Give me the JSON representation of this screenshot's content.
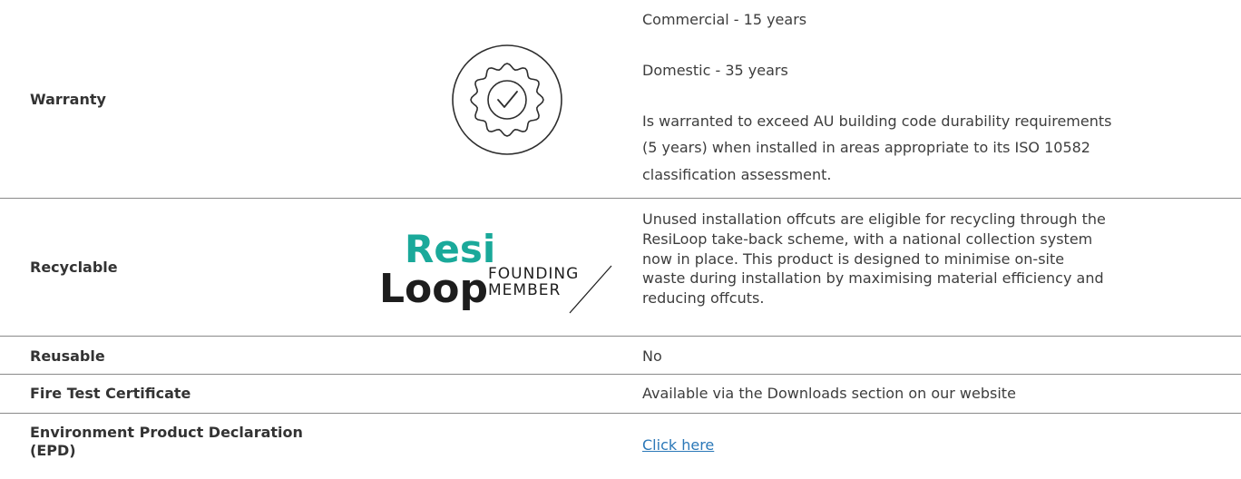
{
  "rows": {
    "warranty": {
      "label": "Warranty",
      "lines": [
        "Commercial - 15 years",
        "Domestic - 35 years",
        "Is warranted to exceed AU building code durability requirements",
        "(5 years) when installed in areas appropriate to its ISO 10582",
        "classification assessment."
      ],
      "icon": "checkmark-badge-icon"
    },
    "recyclable": {
      "label": "Recyclable",
      "lines": [
        "Unused installation offcuts are eligible for recycling through the",
        "ResiLoop take-back scheme, with a national collection system",
        "now in place. This product is designed to minimise on-site",
        "waste during installation by maximising material efficiency and",
        "reducing offcuts."
      ],
      "logo": {
        "word_top": "Resi",
        "word_bottom": "Loop",
        "member_line1": "FOUNDING",
        "member_line2": "MEMBER",
        "accent": "#1aa99a"
      }
    },
    "reusable": {
      "label": "Reusable",
      "value": "No"
    },
    "fire": {
      "label": "Fire Test Certificate",
      "value": "Available via the Downloads section on our website"
    },
    "epd": {
      "label_line1": "Environment Product Declaration",
      "label_line2": "(EPD)",
      "link": "Click here"
    }
  }
}
